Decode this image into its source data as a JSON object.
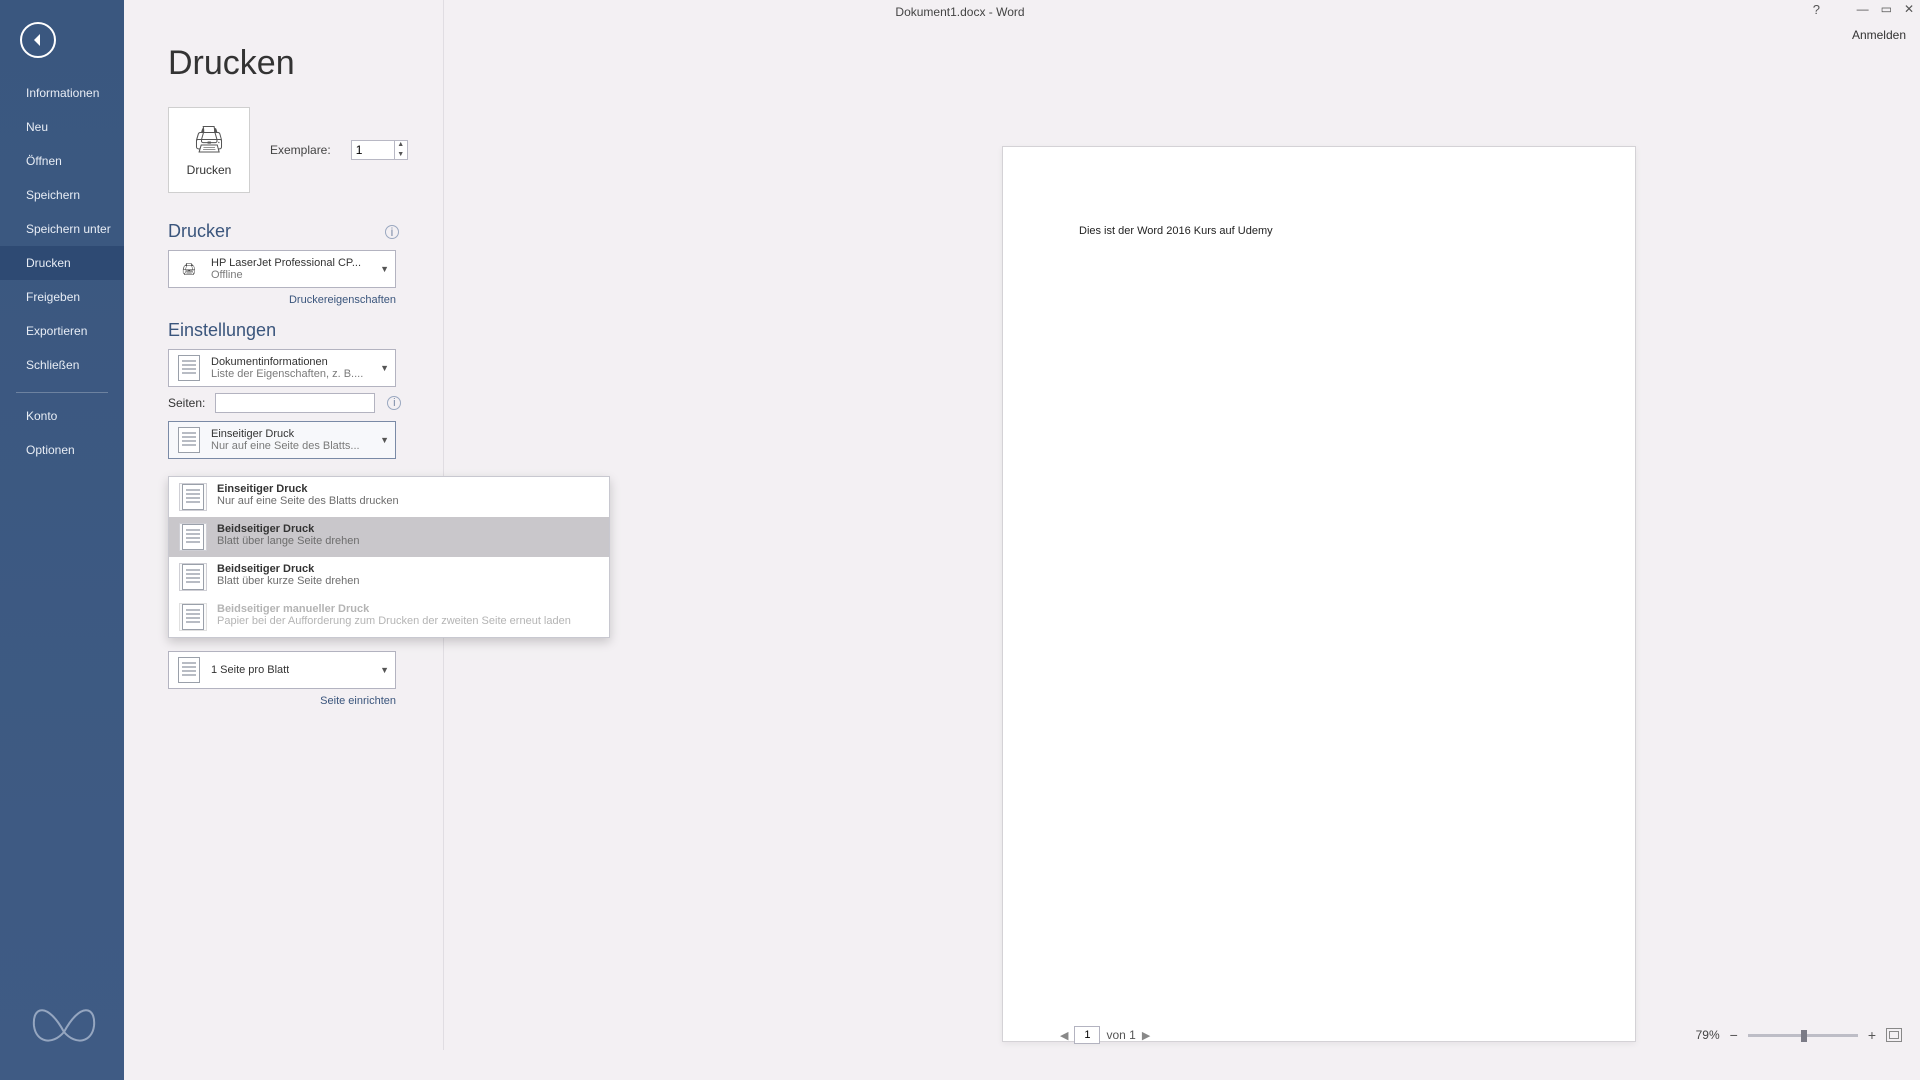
{
  "window": {
    "title": "Dokument1.docx - Word",
    "signin": "Anmelden",
    "help_tooltip": "?"
  },
  "sidebar": {
    "items": [
      "Informationen",
      "Neu",
      "Öffnen",
      "Speichern",
      "Speichern unter",
      "Drucken",
      "Freigeben",
      "Exportieren",
      "Schließen"
    ],
    "items_lower": [
      "Konto",
      "Optionen"
    ],
    "active_index": 5
  },
  "print": {
    "page_title": "Drucken",
    "button_label": "Drucken",
    "copies_label": "Exemplare:",
    "copies_value": "1",
    "printer_section": "Drucker",
    "printer_name": "HP LaserJet Professional CP...",
    "printer_status": "Offline",
    "printer_props": "Druckereigenschaften",
    "settings_section": "Einstellungen",
    "doc_info_title": "Dokumentinformationen",
    "doc_info_sub": "Liste der Eigenschaften, z. B....",
    "pages_label": "Seiten:",
    "pages_value": "",
    "duplex_selected_title": "Einseitiger Druck",
    "duplex_selected_sub": "Nur auf eine Seite des Blatts...",
    "pages_per_sheet": "1 Seite pro Blatt",
    "page_setup": "Seite einrichten"
  },
  "duplex_options": [
    {
      "title": "Einseitiger Druck",
      "sub": "Nur auf eine Seite des Blatts drucken",
      "disabled": false,
      "hover": false
    },
    {
      "title": "Beidseitiger Druck",
      "sub": "Blatt über lange Seite drehen",
      "disabled": false,
      "hover": true
    },
    {
      "title": "Beidseitiger Druck",
      "sub": "Blatt über kurze Seite drehen",
      "disabled": false,
      "hover": false
    },
    {
      "title": "Beidseitiger manueller Druck",
      "sub": "Papier bei der Aufforderung zum Drucken der zweiten Seite erneut laden",
      "disabled": true,
      "hover": false
    }
  ],
  "preview": {
    "doc_text": "Dies ist der Word 2016 Kurs auf Udemy"
  },
  "status": {
    "page_current": "1",
    "page_total": "von 1",
    "zoom": "79%"
  }
}
